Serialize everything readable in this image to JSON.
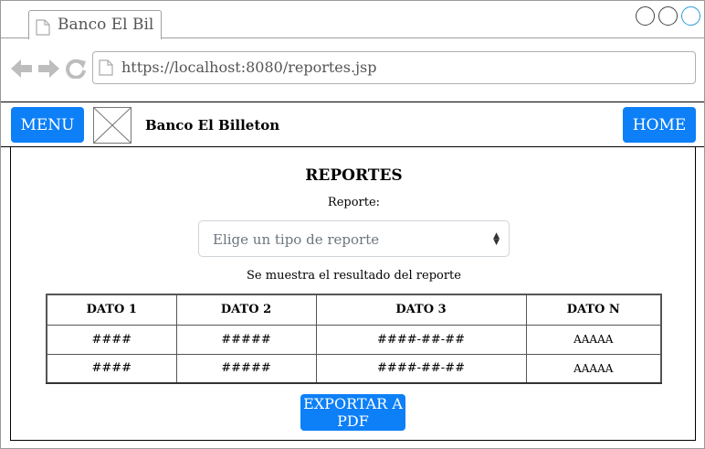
{
  "browser": {
    "tab_title": "Banco El Bil",
    "url": "https://localhost:8080/reportes.jsp"
  },
  "header": {
    "menu_label": "MENU",
    "brand_name": "Banco El Billeton",
    "home_label": "HOME"
  },
  "main": {
    "title": "REPORTES",
    "report_label": "Reporte:",
    "report_select": {
      "placeholder": "Elige un tipo de reporte"
    },
    "result_text": "Se muestra el resultado del reporte",
    "table": {
      "headers": [
        "DATO 1",
        "DATO 2",
        "DATO 3",
        "DATO N"
      ],
      "rows": [
        [
          "####",
          "#####",
          "####-##-##",
          "AAAAA"
        ],
        [
          "####",
          "#####",
          "####-##-##",
          "AAAAA"
        ]
      ]
    },
    "export_label": "EXPORTAR A PDF"
  },
  "colors": {
    "accent": "#0d7ff7",
    "window_control_active": "#2a9fd6"
  },
  "icons": {
    "tab_icon": "document-icon",
    "back": "arrow-left-icon",
    "forward": "arrow-right-icon",
    "reload": "reload-icon",
    "url_icon": "document-icon",
    "logo": "image-placeholder-icon"
  }
}
